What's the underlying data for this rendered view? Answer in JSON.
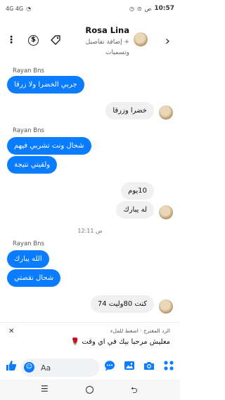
{
  "status_bar": {
    "left_text": "4G 4G",
    "time": "10:57",
    "ampm": "ص"
  },
  "header": {
    "contact_name": "Rosa Lina",
    "subtitle": "+ إضافة تفاصيل وتسميات",
    "icons": [
      "more-icon",
      "dollar-icon",
      "tag-icon",
      "back-icon"
    ]
  },
  "messages": [
    {
      "sender": "Rayan Bns",
      "direction": "outgoing",
      "texts": [
        "جربي الخضرا ولا زرقا"
      ]
    },
    {
      "direction": "incoming",
      "texts": [
        "خضرا وزرقا"
      ]
    },
    {
      "sender": "Rayan Bns",
      "direction": "outgoing",
      "texts": [
        "شحال ونت تشربي فيهم",
        "ولقيتي نتيجة"
      ]
    },
    {
      "direction": "incoming",
      "texts": [
        "10يوم",
        "له يبارك"
      ]
    },
    {
      "time_separator": "12:11 ص"
    },
    {
      "sender": "Rayan Bns",
      "direction": "outgoing",
      "texts": [
        "الله يبارك",
        "شحال نقصتي"
      ]
    },
    {
      "direction": "incoming",
      "texts": [
        "كنت 80وليت 74"
      ]
    }
  ],
  "suggested_reply": {
    "header": "الرد المقترح · اضغط للملء",
    "text": "معليش مرحبا بيك في اي وقت 🌹"
  },
  "composer": {
    "placeholder": "Aa"
  },
  "colors": {
    "outgoing_bubble": "#0a7cff",
    "incoming_bubble": "#f0f0f0",
    "accent": "#0a7cff"
  }
}
